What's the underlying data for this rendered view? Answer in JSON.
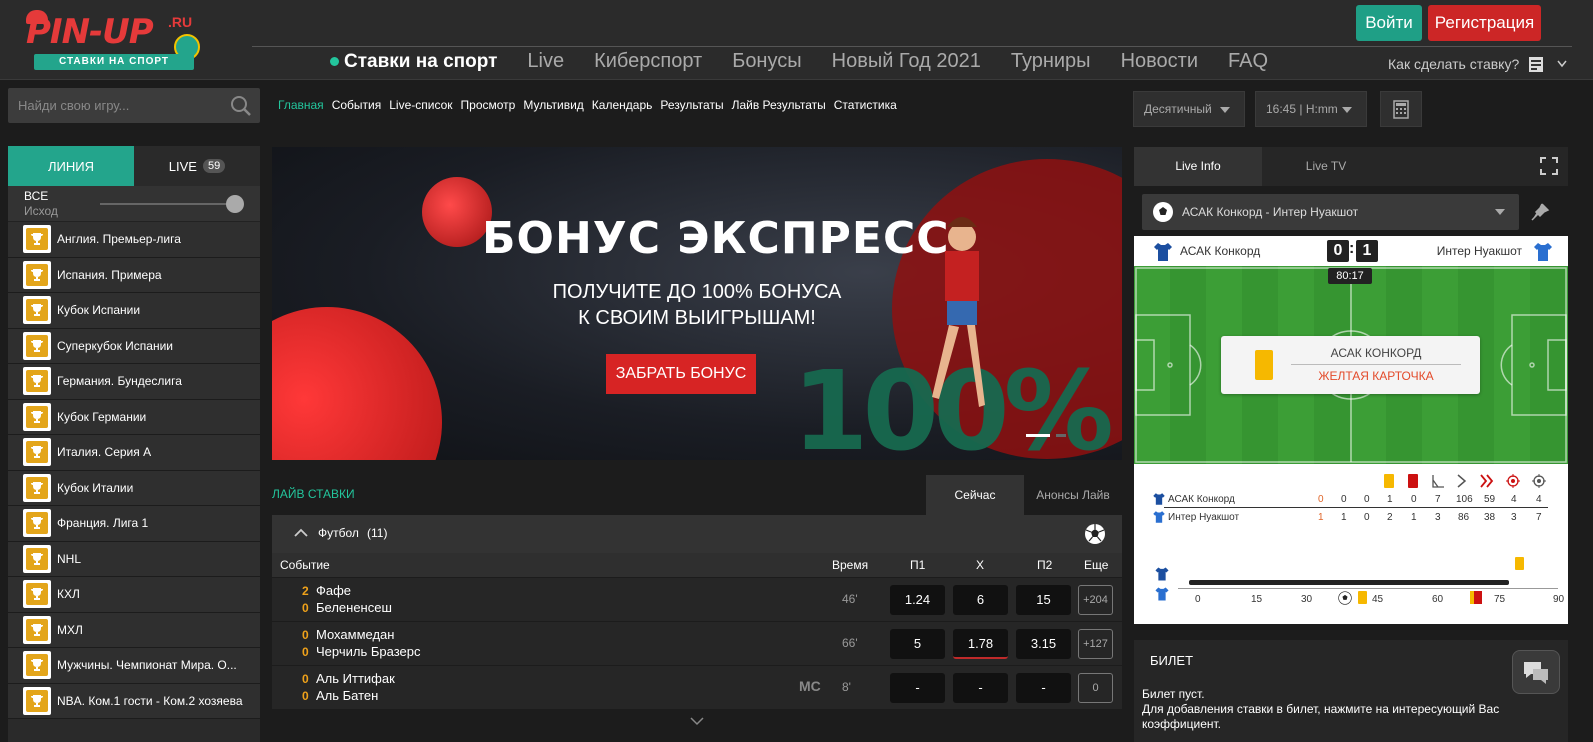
{
  "logo": {
    "text": "PIN-UP",
    "suffix": ".RU",
    "tagline": "СТАВКИ НА СПОРТ"
  },
  "header": {
    "nav": [
      "Ставки на спорт",
      "Live",
      "Киберспорт",
      "Бонусы",
      "Новый Год 2021",
      "Турниры",
      "Новости",
      "FAQ"
    ],
    "login_label": "Войти",
    "register_label": "Регистрация",
    "howto_label": "Как сделать ставку?"
  },
  "search": {
    "placeholder": "Найди свою игру..."
  },
  "subnav": [
    "Главная",
    "События",
    "Live-список",
    "Просмотр",
    "Мультивид",
    "Календарь",
    "Результаты",
    "Лайв Результаты",
    "Статистика"
  ],
  "settings": {
    "odds_format": "Десятичный",
    "time_format": "16:45 | H:mm"
  },
  "sidebar": {
    "tab_line": "ЛИНИЯ",
    "tab_live": "LIVE",
    "live_count": "59",
    "all_label": "ВСЕ",
    "all_sub": "Исход",
    "leagues": [
      "Англия. Премьер-лига",
      "Испания. Примера",
      "Кубок Испании",
      "Суперкубок Испании",
      "Германия. Бундеслига",
      "Кубок Германии",
      "Италия. Серия А",
      "Кубок Италии",
      "Франция. Лига 1",
      "NHL",
      "КХЛ",
      "МХЛ",
      "Мужчины. Чемпионат Мира. О...",
      "NBA. Ком.1 гости - Ком.2 хозяева"
    ]
  },
  "banner": {
    "title": "БОНУС ЭКСПРЕСС",
    "subtitle_1": "ПОЛУЧИТЕ ДО 100% БОНУСА",
    "subtitle_2": "К СВОИМ ВЫИГРЫШАМ!",
    "cta": "ЗАБРАТЬ БОНУС",
    "big": "100%"
  },
  "live_bets": {
    "title": "ЛАЙВ СТАВКИ",
    "tab_now": "Сейчас",
    "tab_announce": "Анонсы Лайв",
    "sport": "Футбол",
    "sport_count": "(11)",
    "columns": {
      "event": "Событие",
      "time": "Время",
      "p1": "П1",
      "x": "Х",
      "p2": "П2",
      "more": "Еще"
    },
    "events": [
      {
        "s1": "2",
        "s2": "0",
        "team1": "Фафе",
        "team2": "Белененсеш",
        "time": "46'",
        "p1": "1.24",
        "x": "6",
        "p2": "15",
        "more": "+204",
        "badge": ""
      },
      {
        "s1": "0",
        "s2": "0",
        "team1": "Мохаммедан",
        "team2": "Черчиль Бразерс",
        "time": "66'",
        "p1": "5",
        "x": "1.78",
        "p2": "3.15",
        "more": "+127",
        "badge": ""
      },
      {
        "s1": "0",
        "s2": "0",
        "team1": "Аль Иттифак",
        "team2": "Аль Батен",
        "time": "8'",
        "p1": "-",
        "x": "-",
        "p2": "-",
        "more": "0",
        "badge": "MC"
      }
    ]
  },
  "live_info": {
    "tab_info": "Live Info",
    "tab_tv": "Live TV",
    "match": "АСАК Конкорд - Интер Нуакшот",
    "team1": "АСАК Конкорд",
    "team2": "Интер Нуакшот",
    "score1": "0",
    "score2": "1",
    "clock": "80:17",
    "event_team": "АСАК КОНКОРД",
    "event_desc": "ЖЕЛТАЯ КАРТОЧКА",
    "stats": [
      {
        "team": "АСАК Конкорд",
        "values": [
          "0",
          "0",
          "0",
          "1",
          "0",
          "7",
          "106",
          "59",
          "4",
          "4"
        ]
      },
      {
        "team": "Интер Нуакшот",
        "values": [
          "1",
          "1",
          "0",
          "2",
          "1",
          "3",
          "86",
          "38",
          "3",
          "7"
        ]
      }
    ],
    "timeline_ticks": [
      "0",
      "15",
      "30",
      "45",
      "60",
      "75",
      "90"
    ]
  },
  "ticket": {
    "title": "БИЛЕТ",
    "empty": "Билет пуст.",
    "hint": "Для добавления ставки в билет, нажмите на интересующий Вас коэффициент."
  },
  "colors": {
    "accent": "#23a58c",
    "red": "#cc2626",
    "gold": "#f0a21a"
  }
}
